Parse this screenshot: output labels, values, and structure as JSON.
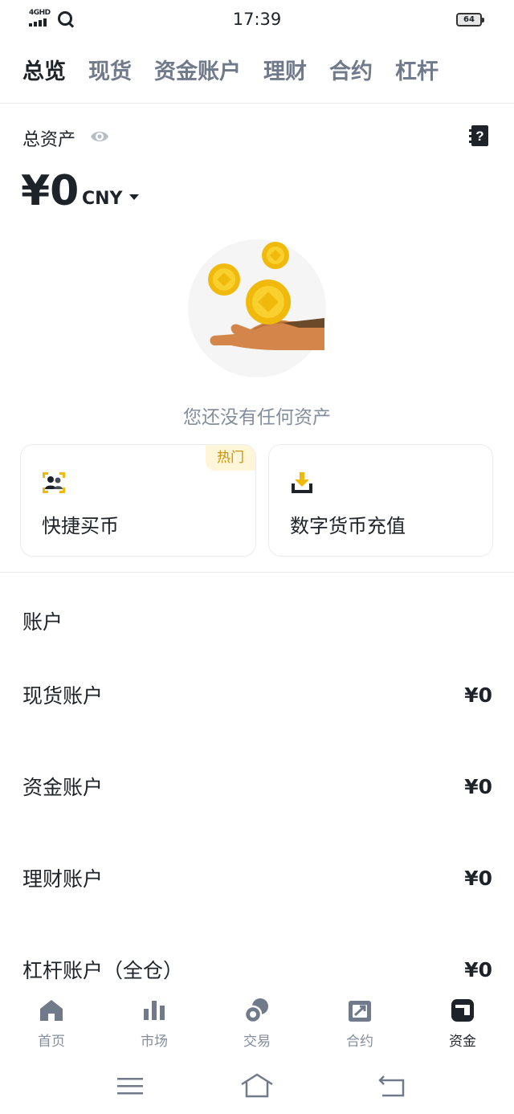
{
  "status_bar": {
    "network": "4GHD",
    "time": "17:39",
    "battery": "64"
  },
  "top_tabs": [
    {
      "label": "总览",
      "active": true
    },
    {
      "label": "现货",
      "active": false
    },
    {
      "label": "资金账户",
      "active": false
    },
    {
      "label": "理财",
      "active": false
    },
    {
      "label": "合约",
      "active": false
    },
    {
      "label": "杠杆",
      "active": false
    }
  ],
  "overview": {
    "total_label": "总资产",
    "total_value": "¥0",
    "currency": "CNY",
    "empty_text": "您还没有任何资产"
  },
  "quick_actions": {
    "buy": {
      "label": "快捷买币",
      "badge": "热门",
      "icon": "buy-users-icon"
    },
    "deposit": {
      "label": "数字货币充值",
      "icon": "download-tray-icon"
    }
  },
  "accounts": {
    "title": "账户",
    "rows": [
      {
        "name": "现货账户",
        "value": "¥0"
      },
      {
        "name": "资金账户",
        "value": "¥0"
      },
      {
        "name": "理财账户",
        "value": "¥0"
      },
      {
        "name": "杠杆账户（全仓）",
        "value": "¥0"
      }
    ]
  },
  "bottom_nav": [
    {
      "label": "首页",
      "icon": "home-icon",
      "active": false
    },
    {
      "label": "市场",
      "icon": "bar-chart-icon",
      "active": false
    },
    {
      "label": "交易",
      "icon": "exchange-icon",
      "active": false
    },
    {
      "label": "合约",
      "icon": "contract-icon",
      "active": false
    },
    {
      "label": "资金",
      "icon": "wallet-icon",
      "active": true
    }
  ],
  "colors": {
    "text_primary": "#1e2329",
    "text_secondary": "#848e9c",
    "accent_yellow": "#f0b90b",
    "hot_badge_bg": "#fff5d9",
    "hot_badge_text": "#c99400"
  }
}
